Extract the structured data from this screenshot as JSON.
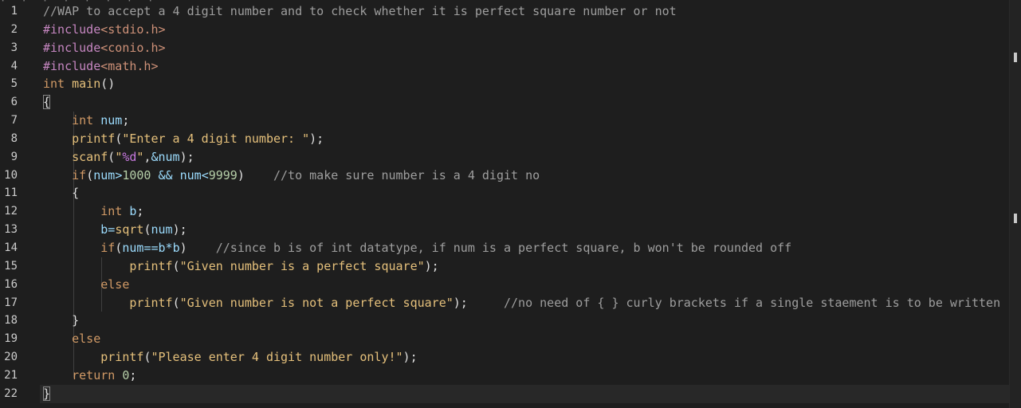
{
  "editor": {
    "top_cut_text": "· · · · · · · ·",
    "line_numbers": [
      "1",
      "2",
      "3",
      "4",
      "5",
      "6",
      "7",
      "8",
      "9",
      "10",
      "11",
      "12",
      "13",
      "14",
      "15",
      "16",
      "17",
      "18",
      "19",
      "20",
      "21",
      "22"
    ],
    "lines": [
      {
        "tokens": [
          {
            "t": "cm",
            "v": "//WAP to accept a 4 digit number and to check whether it is perfect square number or not"
          }
        ]
      },
      {
        "tokens": [
          {
            "t": "k",
            "v": "#include"
          },
          {
            "t": "inc",
            "v": "<stdio.h>"
          }
        ]
      },
      {
        "tokens": [
          {
            "t": "k",
            "v": "#include"
          },
          {
            "t": "inc",
            "v": "<conio.h>"
          }
        ]
      },
      {
        "tokens": [
          {
            "t": "k",
            "v": "#include"
          },
          {
            "t": "inc",
            "v": "<math.h>"
          }
        ]
      },
      {
        "tokens": [
          {
            "t": "kw",
            "v": "int"
          },
          {
            "t": "punc",
            "v": " "
          },
          {
            "t": "fn",
            "v": "main"
          },
          {
            "t": "punc",
            "v": "()"
          }
        ]
      },
      {
        "tokens": [
          {
            "t": "punc",
            "v": "{",
            "box": true
          }
        ]
      },
      {
        "tokens": [
          {
            "t": "punc",
            "v": "    "
          },
          {
            "t": "kw",
            "v": "int"
          },
          {
            "t": "punc",
            "v": " "
          },
          {
            "t": "var",
            "v": "num"
          },
          {
            "t": "punc",
            "v": ";"
          }
        ]
      },
      {
        "tokens": [
          {
            "t": "punc",
            "v": "    "
          },
          {
            "t": "fn",
            "v": "printf"
          },
          {
            "t": "punc",
            "v": "("
          },
          {
            "t": "str",
            "v": "\"Enter a 4 digit number: \""
          },
          {
            "t": "punc",
            "v": ");"
          }
        ]
      },
      {
        "tokens": [
          {
            "t": "punc",
            "v": "    "
          },
          {
            "t": "fn",
            "v": "scanf"
          },
          {
            "t": "punc",
            "v": "("
          },
          {
            "t": "str",
            "v": "\""
          },
          {
            "t": "fmt",
            "v": "%d"
          },
          {
            "t": "str",
            "v": "\""
          },
          {
            "t": "punc",
            "v": ","
          },
          {
            "t": "op",
            "v": "&"
          },
          {
            "t": "var",
            "v": "num"
          },
          {
            "t": "punc",
            "v": ");"
          }
        ]
      },
      {
        "tokens": [
          {
            "t": "punc",
            "v": "    "
          },
          {
            "t": "kw",
            "v": "if"
          },
          {
            "t": "punc",
            "v": "("
          },
          {
            "t": "var",
            "v": "num"
          },
          {
            "t": "op",
            "v": ">"
          },
          {
            "t": "num",
            "v": "1000"
          },
          {
            "t": "punc",
            "v": " "
          },
          {
            "t": "op",
            "v": "&&"
          },
          {
            "t": "punc",
            "v": " "
          },
          {
            "t": "var",
            "v": "num"
          },
          {
            "t": "op",
            "v": "<"
          },
          {
            "t": "num",
            "v": "9999"
          },
          {
            "t": "punc",
            "v": ")    "
          },
          {
            "t": "cm",
            "v": "//to make sure number is a 4 digit no"
          }
        ]
      },
      {
        "tokens": [
          {
            "t": "punc",
            "v": "    {"
          }
        ]
      },
      {
        "tokens": [
          {
            "t": "punc",
            "v": "        "
          },
          {
            "t": "kw",
            "v": "int"
          },
          {
            "t": "punc",
            "v": " "
          },
          {
            "t": "var",
            "v": "b"
          },
          {
            "t": "punc",
            "v": ";"
          }
        ]
      },
      {
        "tokens": [
          {
            "t": "punc",
            "v": "        "
          },
          {
            "t": "var",
            "v": "b"
          },
          {
            "t": "op",
            "v": "="
          },
          {
            "t": "fn",
            "v": "sqrt"
          },
          {
            "t": "punc",
            "v": "("
          },
          {
            "t": "var",
            "v": "num"
          },
          {
            "t": "punc",
            "v": ");"
          }
        ]
      },
      {
        "tokens": [
          {
            "t": "punc",
            "v": "        "
          },
          {
            "t": "kw",
            "v": "if"
          },
          {
            "t": "punc",
            "v": "("
          },
          {
            "t": "var",
            "v": "num"
          },
          {
            "t": "op",
            "v": "=="
          },
          {
            "t": "var",
            "v": "b"
          },
          {
            "t": "op",
            "v": "*"
          },
          {
            "t": "var",
            "v": "b"
          },
          {
            "t": "punc",
            "v": ")    "
          },
          {
            "t": "cm",
            "v": "//since b is of int datatype, if num is a perfect square, b won't be rounded off"
          }
        ]
      },
      {
        "tokens": [
          {
            "t": "punc",
            "v": "            "
          },
          {
            "t": "fn",
            "v": "printf"
          },
          {
            "t": "punc",
            "v": "("
          },
          {
            "t": "str",
            "v": "\"Given number is a perfect square\""
          },
          {
            "t": "punc",
            "v": ");"
          }
        ]
      },
      {
        "tokens": [
          {
            "t": "punc",
            "v": "        "
          },
          {
            "t": "kw",
            "v": "else"
          }
        ]
      },
      {
        "tokens": [
          {
            "t": "punc",
            "v": "            "
          },
          {
            "t": "fn",
            "v": "printf"
          },
          {
            "t": "punc",
            "v": "("
          },
          {
            "t": "str",
            "v": "\"Given number is not a perfect square\""
          },
          {
            "t": "punc",
            "v": ");     "
          },
          {
            "t": "cm",
            "v": "//no need of { } curly brackets if a single staement is to be written"
          }
        ]
      },
      {
        "tokens": [
          {
            "t": "punc",
            "v": "    }"
          }
        ]
      },
      {
        "tokens": [
          {
            "t": "punc",
            "v": "    "
          },
          {
            "t": "kw",
            "v": "else"
          }
        ]
      },
      {
        "tokens": [
          {
            "t": "punc",
            "v": "        "
          },
          {
            "t": "fn",
            "v": "printf"
          },
          {
            "t": "punc",
            "v": "("
          },
          {
            "t": "str",
            "v": "\"Please enter 4 digit number only!\""
          },
          {
            "t": "punc",
            "v": ");"
          }
        ]
      },
      {
        "tokens": [
          {
            "t": "punc",
            "v": "    "
          },
          {
            "t": "kw",
            "v": "return"
          },
          {
            "t": "punc",
            "v": " "
          },
          {
            "t": "num",
            "v": "0"
          },
          {
            "t": "punc",
            "v": ";"
          }
        ]
      },
      {
        "tokens": [
          {
            "t": "punc",
            "v": "}",
            "box": true
          }
        ]
      }
    ],
    "current_line": 22
  },
  "colors": {
    "background": "#1e1e1e",
    "comment": "#9e9e9e",
    "keyword": "#d19a66",
    "string": "#e5c07b",
    "preprocessor": "#c586c0",
    "identifier": "#9cdcfe"
  }
}
